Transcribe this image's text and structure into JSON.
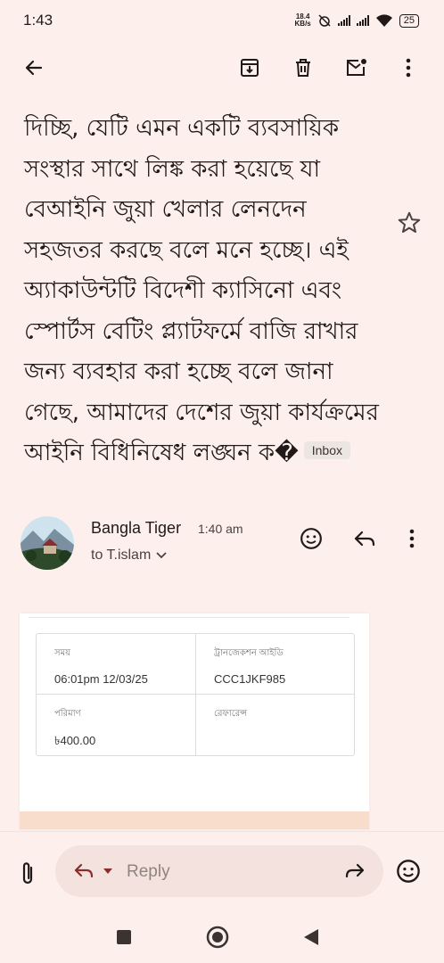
{
  "status_bar": {
    "time": "1:43",
    "net_speed_value": "18.4",
    "net_speed_unit": "KB/s",
    "battery": "25"
  },
  "toolbar": {
    "icons": [
      "back-arrow-icon",
      "archive-icon",
      "delete-icon",
      "mark-unread-icon",
      "more-vert-icon"
    ]
  },
  "email": {
    "body_text": "দিচ্ছি, যেটি এমন একটি ব্যবসায়িক সংস্থার সাথে লিঙ্ক করা হয়েছে যা বেআইনি জুয়া খেলার লেনদেন সহজতর করছে বলে মনে হচ্ছে। এই অ্যাকাউন্টটি বিদেশী ক্যাসিনো এবং স্পোর্টস বেটিং প্ল্যাটফর্মে বাজি রাখার জন্য ব্যবহার করা হচ্ছে বলে জানা গেছে, আমাদের দেশের জুয়া কার্যক্রমের আইনি বিধিনিষেধ লঙ্ঘন ক�",
    "label_chip": "Inbox"
  },
  "message": {
    "sender_name": "Bangla Tiger",
    "time": "1:40 am",
    "recipient": "to T.islam"
  },
  "receipt": {
    "cells": [
      {
        "label": "সময়",
        "value": "06:01pm 12/03/25"
      },
      {
        "label": "ট্রানজেকশন আইডি",
        "value": "CCC1JKF985"
      },
      {
        "label": "পরিমাণ",
        "value": "৳400.00"
      },
      {
        "label": "রেফারেন্স",
        "value": ""
      }
    ]
  },
  "reply_bar": {
    "reply_label": "Reply"
  },
  "colors": {
    "background": "#fdf0ec",
    "reply_pill": "#f3e2dd",
    "receipt_footer": "#f8dccc"
  }
}
